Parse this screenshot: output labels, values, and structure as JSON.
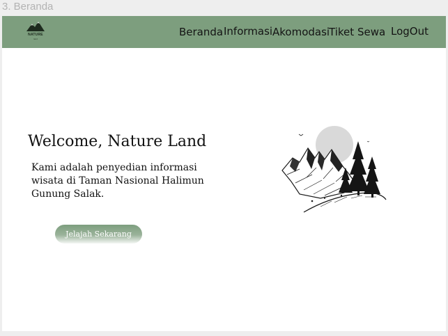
{
  "frame": {
    "label": "3. Beranda"
  },
  "header": {
    "logo": {
      "text": "NATURE",
      "subtext": "land"
    },
    "nav": [
      {
        "label": "Beranda"
      },
      {
        "label": "Informasi"
      },
      {
        "label": "Akomodasi"
      },
      {
        "label": "Tiket"
      },
      {
        "label": "Sewa"
      },
      {
        "label": "LogOut"
      }
    ]
  },
  "hero": {
    "title": "Welcome, Nature Land",
    "description": "Kami adalah penyedian informasi wisata di Taman Nasional Halimun Gunung Salak.",
    "button_label": "Jelajah Sekarang",
    "illustration_icon": "mountain-forest-illustration"
  },
  "colors": {
    "navbar": "#7d9e7e",
    "page_background": "#ffffff",
    "frame_background": "#eeeeee",
    "button_gradient_start": "#7d9e7e",
    "button_gradient_end": "#f4f7f4",
    "sun": "#d9d9d9"
  }
}
